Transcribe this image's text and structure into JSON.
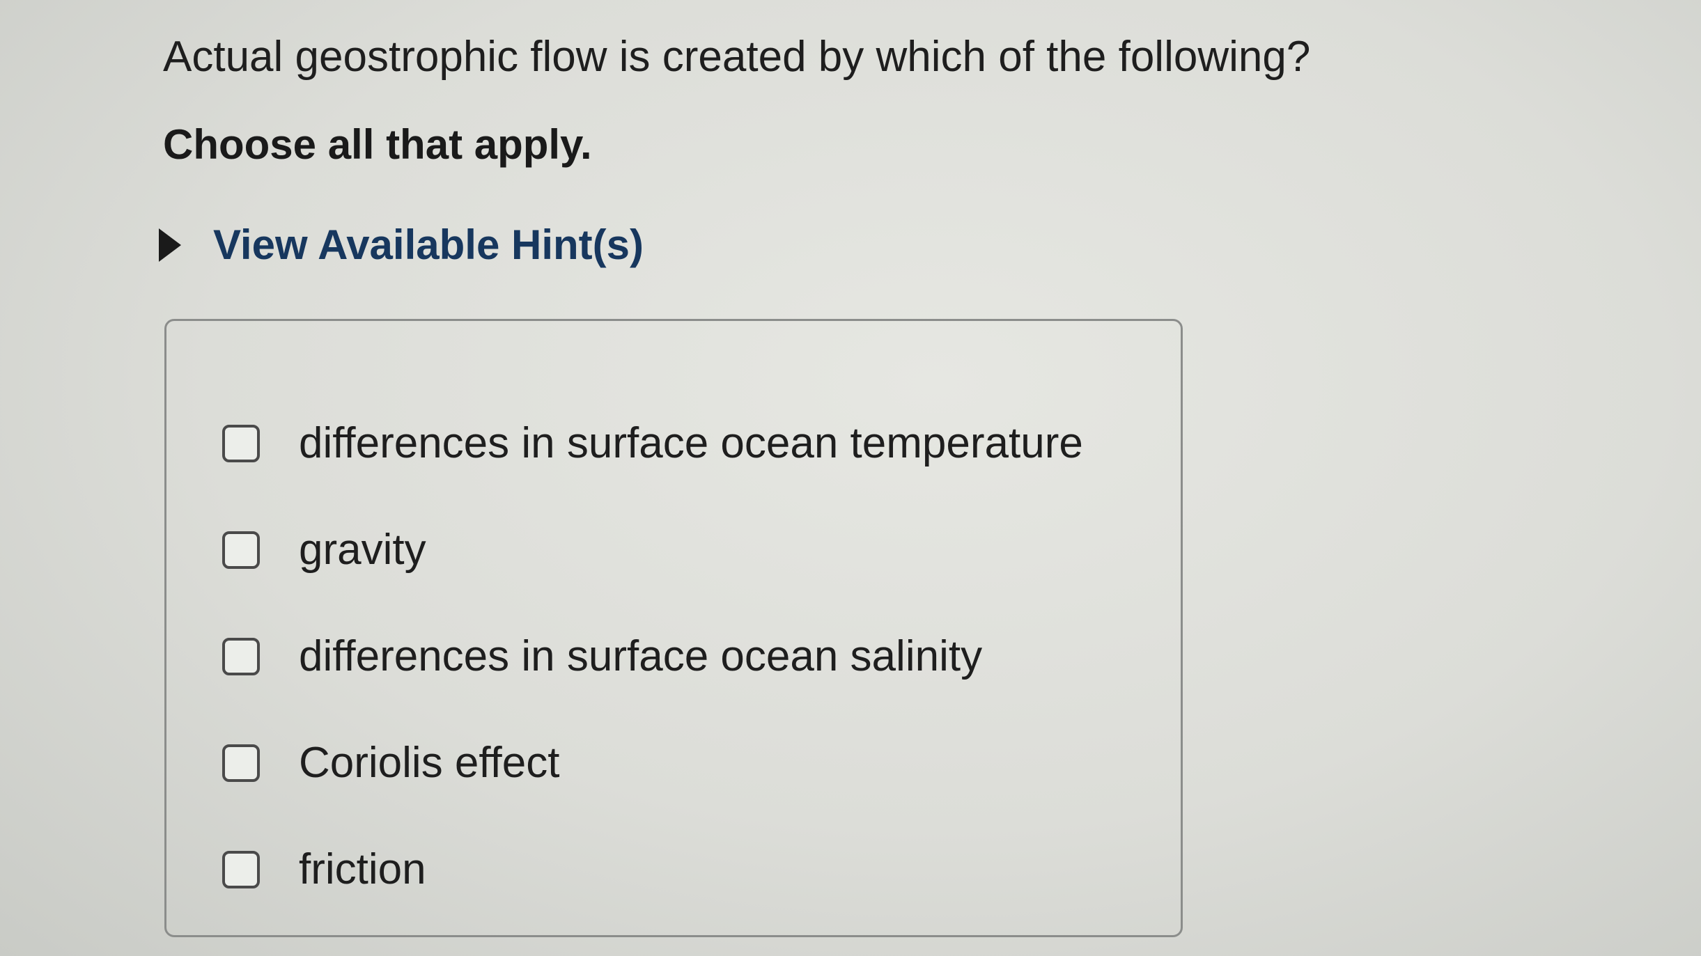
{
  "question": {
    "text": "Actual geostrophic flow is created by which of the following?",
    "instruction": "Choose all that apply."
  },
  "hint": {
    "label": "View Available Hint(s)",
    "icon": "triangle-right-icon",
    "color": "#17375e"
  },
  "choices": [
    {
      "label": "differences in surface ocean temperature",
      "checked": false
    },
    {
      "label": "gravity",
      "checked": false
    },
    {
      "label": "differences in surface ocean salinity",
      "checked": false
    },
    {
      "label": "Coriolis effect",
      "checked": false
    },
    {
      "label": "friction",
      "checked": false
    }
  ]
}
